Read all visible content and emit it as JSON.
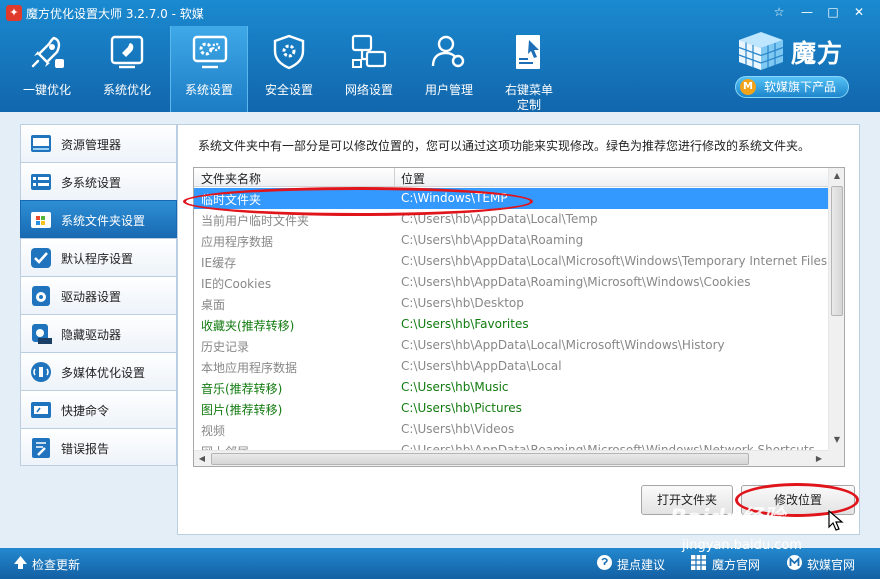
{
  "window": {
    "title": "魔方优化设置大师 3.2.7.0 - 软媒",
    "app_icon_glyph": "✦",
    "controls": [
      "☆",
      "—",
      "□",
      "✕"
    ]
  },
  "toolbar": {
    "items": [
      {
        "label": "一键优化",
        "icon": "rocket-icon"
      },
      {
        "label": "系统优化",
        "icon": "system-optimize-icon"
      },
      {
        "label": "系统设置",
        "icon": "gear-monitor-icon",
        "active": true
      },
      {
        "label": "安全设置",
        "icon": "shield-icon"
      },
      {
        "label": "网络设置",
        "icon": "network-icon"
      },
      {
        "label": "用户管理",
        "icon": "users-icon"
      },
      {
        "label": "右键菜单\n定制",
        "label_line1": "右键菜单",
        "label_line2": "定制",
        "icon": "context-menu-icon"
      }
    ]
  },
  "brand": {
    "name": "魔方",
    "badge_letter": "M",
    "tagline": "软媒旗下产品"
  },
  "sidebar": {
    "items": [
      {
        "label": "资源管理器",
        "icon": "explorer-icon"
      },
      {
        "label": "多系统设置",
        "icon": "multi-system-icon"
      },
      {
        "label": "系统文件夹设置",
        "icon": "windows-folder-icon",
        "active": true
      },
      {
        "label": "默认程序设置",
        "icon": "checkmark-icon"
      },
      {
        "label": "驱动器设置",
        "icon": "drive-icon"
      },
      {
        "label": "隐藏驱动器",
        "icon": "hidden-drive-icon"
      },
      {
        "label": "多媒体优化设置",
        "icon": "multimedia-icon"
      },
      {
        "label": "快捷命令",
        "icon": "shortcut-command-icon"
      },
      {
        "label": "错误报告",
        "icon": "error-report-icon"
      }
    ]
  },
  "main": {
    "description": "系统文件夹中有一部分是可以修改位置的，您可以通过这项功能来实现修改。绿色为推荐您进行修改的系统文件夹。",
    "list": {
      "columns": [
        "文件夹名称",
        "位置"
      ],
      "rows": [
        {
          "name": "临时文件夹",
          "path": "C:\\Windows\\TEMP",
          "style": "selected"
        },
        {
          "name": "当前用户临时文件夹",
          "path": "C:\\Users\\hb\\AppData\\Local\\Temp",
          "style": "gray"
        },
        {
          "name": "应用程序数据",
          "path": "C:\\Users\\hb\\AppData\\Roaming",
          "style": "gray"
        },
        {
          "name": "IE缓存",
          "path": "C:\\Users\\hb\\AppData\\Local\\Microsoft\\Windows\\Temporary Internet Files",
          "style": "gray"
        },
        {
          "name": "IE的Cookies",
          "path": "C:\\Users\\hb\\AppData\\Roaming\\Microsoft\\Windows\\Cookies",
          "style": "gray"
        },
        {
          "name": "桌面",
          "path": "C:\\Users\\hb\\Desktop",
          "style": "gray"
        },
        {
          "name": "收藏夹(推荐转移)",
          "path": "C:\\Users\\hb\\Favorites",
          "style": "green"
        },
        {
          "name": "历史记录",
          "path": "C:\\Users\\hb\\AppData\\Local\\Microsoft\\Windows\\History",
          "style": "gray"
        },
        {
          "name": "本地应用程序数据",
          "path": "C:\\Users\\hb\\AppData\\Local",
          "style": "gray"
        },
        {
          "name": "音乐(推荐转移)",
          "path": "C:\\Users\\hb\\Music",
          "style": "green"
        },
        {
          "name": "图片(推荐转移)",
          "path": "C:\\Users\\hb\\Pictures",
          "style": "green"
        },
        {
          "name": "视频",
          "path": "C:\\Users\\hb\\Videos",
          "style": "gray"
        },
        {
          "name": "网上邻居",
          "path": "C:\\Users\\hb\\AppData\\Roaming\\Microsoft\\Windows\\Network Shortcuts",
          "style": "gray"
        }
      ]
    },
    "buttons": {
      "open_folder": "打开文件夹",
      "change_location": "修改位置"
    }
  },
  "statusbar": {
    "check_update": "检查更新",
    "feedback": "提点建议",
    "mofang_site": "魔方官网",
    "ruanmei_site": "软媒官网"
  },
  "watermark": {
    "brand": "Baidu经验",
    "url": "jingyan.baidu.com"
  },
  "colors": {
    "accent": "#1869b2",
    "selection": "#3399ff",
    "recommended_text": "#127b0f",
    "muted_text": "#888888",
    "annotation": "#e0141b"
  }
}
